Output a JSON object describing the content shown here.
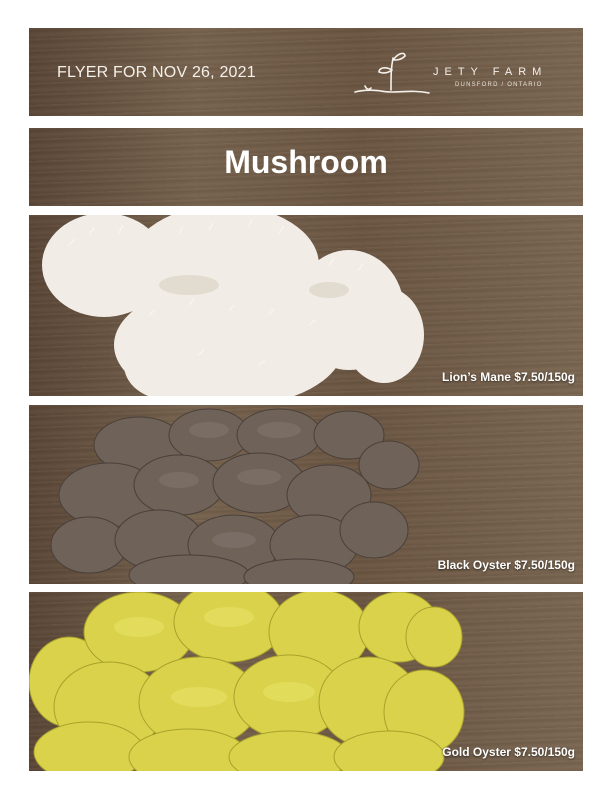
{
  "header": {
    "flyer_date": "FLYER FOR NOV 26, 2021",
    "logo": {
      "icon": "sprout-icon",
      "name": "JETY FARM",
      "location": "DUNSFORD / ONTARIO"
    }
  },
  "title": "Mushroom",
  "products": [
    {
      "image": "lions-mane-mushroom",
      "label": "Lion’s Mane $7.50/150g",
      "color": "#f1ede6"
    },
    {
      "image": "black-oyster-mushroom",
      "label": "Black Oyster $7.50/150g",
      "color": "#6e6259"
    },
    {
      "image": "gold-oyster-mushroom",
      "label": "Gold Oyster $7.50/150g",
      "color": "#d9d24a"
    }
  ]
}
